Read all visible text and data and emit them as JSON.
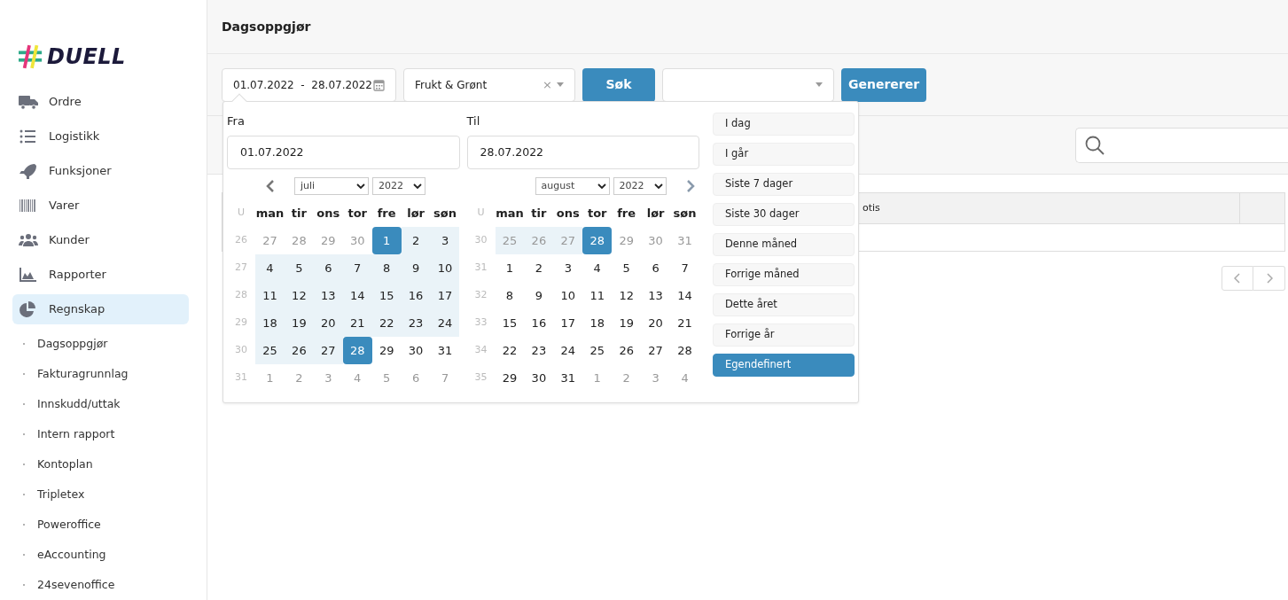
{
  "logo": {
    "text": "DUELL"
  },
  "sidebar": {
    "items": [
      {
        "label": "Ordre",
        "selected": false
      },
      {
        "label": "Logistikk",
        "selected": false
      },
      {
        "label": "Funksjoner",
        "selected": false
      },
      {
        "label": "Varer",
        "selected": false
      },
      {
        "label": "Kunder",
        "selected": false
      },
      {
        "label": "Rapporter",
        "selected": false
      },
      {
        "label": "Regnskap",
        "selected": true,
        "children": [
          {
            "label": "Dagsoppgjør"
          },
          {
            "label": "Fakturagrunnlag"
          },
          {
            "label": "Innskudd/uttak"
          },
          {
            "label": "Intern rapport"
          },
          {
            "label": "Kontoplan"
          },
          {
            "label": "Tripletex"
          },
          {
            "label": "Poweroffice"
          },
          {
            "label": "eAccounting"
          },
          {
            "label": "24sevenoffice"
          }
        ]
      }
    ]
  },
  "header": {
    "title": "Dagsoppgjør"
  },
  "toolbar": {
    "date_range": "01.07.2022  -  28.07.2022",
    "department": "Frukt & Grønt",
    "clear": "×",
    "search_button": "Søk",
    "generate_button": "Genererer"
  },
  "table": {
    "columns": [
      "otis"
    ]
  },
  "datepicker": {
    "from": {
      "label": "Fra",
      "value": "01.07.2022",
      "month": "juli",
      "year": "2022",
      "week_label": "U",
      "weekdays": [
        "man",
        "tir",
        "ons",
        "tor",
        "fre",
        "lør",
        "søn"
      ],
      "weeks": [
        {
          "week": "26",
          "days": [
            {
              "d": "27",
              "muted": true,
              "range": false,
              "selected": false
            },
            {
              "d": "28",
              "muted": true,
              "range": false,
              "selected": false
            },
            {
              "d": "29",
              "muted": true,
              "range": false,
              "selected": false
            },
            {
              "d": "30",
              "muted": true,
              "range": false,
              "selected": false
            },
            {
              "d": "1",
              "muted": false,
              "range": true,
              "selected": true
            },
            {
              "d": "2",
              "muted": false,
              "range": true,
              "selected": false
            },
            {
              "d": "3",
              "muted": false,
              "range": true,
              "selected": false
            }
          ]
        },
        {
          "week": "27",
          "days": [
            {
              "d": "4",
              "muted": false,
              "range": true,
              "selected": false
            },
            {
              "d": "5",
              "muted": false,
              "range": true,
              "selected": false
            },
            {
              "d": "6",
              "muted": false,
              "range": true,
              "selected": false
            },
            {
              "d": "7",
              "muted": false,
              "range": true,
              "selected": false
            },
            {
              "d": "8",
              "muted": false,
              "range": true,
              "selected": false
            },
            {
              "d": "9",
              "muted": false,
              "range": true,
              "selected": false
            },
            {
              "d": "10",
              "muted": false,
              "range": true,
              "selected": false
            }
          ]
        },
        {
          "week": "28",
          "days": [
            {
              "d": "11",
              "muted": false,
              "range": true,
              "selected": false
            },
            {
              "d": "12",
              "muted": false,
              "range": true,
              "selected": false
            },
            {
              "d": "13",
              "muted": false,
              "range": true,
              "selected": false
            },
            {
              "d": "14",
              "muted": false,
              "range": true,
              "selected": false
            },
            {
              "d": "15",
              "muted": false,
              "range": true,
              "selected": false
            },
            {
              "d": "16",
              "muted": false,
              "range": true,
              "selected": false
            },
            {
              "d": "17",
              "muted": false,
              "range": true,
              "selected": false
            }
          ]
        },
        {
          "week": "29",
          "days": [
            {
              "d": "18",
              "muted": false,
              "range": true,
              "selected": false
            },
            {
              "d": "19",
              "muted": false,
              "range": true,
              "selected": false
            },
            {
              "d": "20",
              "muted": false,
              "range": true,
              "selected": false
            },
            {
              "d": "21",
              "muted": false,
              "range": true,
              "selected": false
            },
            {
              "d": "22",
              "muted": false,
              "range": true,
              "selected": false
            },
            {
              "d": "23",
              "muted": false,
              "range": true,
              "selected": false
            },
            {
              "d": "24",
              "muted": false,
              "range": true,
              "selected": false
            }
          ]
        },
        {
          "week": "30",
          "days": [
            {
              "d": "25",
              "muted": false,
              "range": true,
              "selected": false
            },
            {
              "d": "26",
              "muted": false,
              "range": true,
              "selected": false
            },
            {
              "d": "27",
              "muted": false,
              "range": true,
              "selected": false
            },
            {
              "d": "28",
              "muted": false,
              "range": true,
              "selected": true
            },
            {
              "d": "29",
              "muted": false,
              "range": false,
              "selected": false
            },
            {
              "d": "30",
              "muted": false,
              "range": false,
              "selected": false
            },
            {
              "d": "31",
              "muted": false,
              "range": false,
              "selected": false
            }
          ]
        },
        {
          "week": "31",
          "days": [
            {
              "d": "1",
              "muted": true,
              "range": false,
              "selected": false
            },
            {
              "d": "2",
              "muted": true,
              "range": false,
              "selected": false
            },
            {
              "d": "3",
              "muted": true,
              "range": false,
              "selected": false
            },
            {
              "d": "4",
              "muted": true,
              "range": false,
              "selected": false
            },
            {
              "d": "5",
              "muted": true,
              "range": false,
              "selected": false
            },
            {
              "d": "6",
              "muted": true,
              "range": false,
              "selected": false
            },
            {
              "d": "7",
              "muted": true,
              "range": false,
              "selected": false
            }
          ]
        }
      ]
    },
    "to": {
      "label": "Til",
      "value": "28.07.2022",
      "month": "august",
      "year": "2022",
      "week_label": "U",
      "weekdays": [
        "man",
        "tir",
        "ons",
        "tor",
        "fre",
        "lør",
        "søn"
      ],
      "weeks": [
        {
          "week": "30",
          "days": [
            {
              "d": "25",
              "muted": true,
              "range": true,
              "selected": false
            },
            {
              "d": "26",
              "muted": true,
              "range": true,
              "selected": false
            },
            {
              "d": "27",
              "muted": true,
              "range": true,
              "selected": false
            },
            {
              "d": "28",
              "muted": true,
              "range": true,
              "selected": true
            },
            {
              "d": "29",
              "muted": true,
              "range": false,
              "selected": false
            },
            {
              "d": "30",
              "muted": true,
              "range": false,
              "selected": false
            },
            {
              "d": "31",
              "muted": true,
              "range": false,
              "selected": false
            }
          ]
        },
        {
          "week": "31",
          "days": [
            {
              "d": "1",
              "muted": false,
              "range": false,
              "selected": false
            },
            {
              "d": "2",
              "muted": false,
              "range": false,
              "selected": false
            },
            {
              "d": "3",
              "muted": false,
              "range": false,
              "selected": false
            },
            {
              "d": "4",
              "muted": false,
              "range": false,
              "selected": false
            },
            {
              "d": "5",
              "muted": false,
              "range": false,
              "selected": false
            },
            {
              "d": "6",
              "muted": false,
              "range": false,
              "selected": false
            },
            {
              "d": "7",
              "muted": false,
              "range": false,
              "selected": false
            }
          ]
        },
        {
          "week": "32",
          "days": [
            {
              "d": "8",
              "muted": false,
              "range": false,
              "selected": false
            },
            {
              "d": "9",
              "muted": false,
              "range": false,
              "selected": false
            },
            {
              "d": "10",
              "muted": false,
              "range": false,
              "selected": false
            },
            {
              "d": "11",
              "muted": false,
              "range": false,
              "selected": false
            },
            {
              "d": "12",
              "muted": false,
              "range": false,
              "selected": false
            },
            {
              "d": "13",
              "muted": false,
              "range": false,
              "selected": false
            },
            {
              "d": "14",
              "muted": false,
              "range": false,
              "selected": false
            }
          ]
        },
        {
          "week": "33",
          "days": [
            {
              "d": "15",
              "muted": false,
              "range": false,
              "selected": false
            },
            {
              "d": "16",
              "muted": false,
              "range": false,
              "selected": false
            },
            {
              "d": "17",
              "muted": false,
              "range": false,
              "selected": false
            },
            {
              "d": "18",
              "muted": false,
              "range": false,
              "selected": false
            },
            {
              "d": "19",
              "muted": false,
              "range": false,
              "selected": false
            },
            {
              "d": "20",
              "muted": false,
              "range": false,
              "selected": false
            },
            {
              "d": "21",
              "muted": false,
              "range": false,
              "selected": false
            }
          ]
        },
        {
          "week": "34",
          "days": [
            {
              "d": "22",
              "muted": false,
              "range": false,
              "selected": false
            },
            {
              "d": "23",
              "muted": false,
              "range": false,
              "selected": false
            },
            {
              "d": "24",
              "muted": false,
              "range": false,
              "selected": false
            },
            {
              "d": "25",
              "muted": false,
              "range": false,
              "selected": false
            },
            {
              "d": "26",
              "muted": false,
              "range": false,
              "selected": false
            },
            {
              "d": "27",
              "muted": false,
              "range": false,
              "selected": false
            },
            {
              "d": "28",
              "muted": false,
              "range": false,
              "selected": false
            }
          ]
        },
        {
          "week": "35",
          "days": [
            {
              "d": "29",
              "muted": false,
              "range": false,
              "selected": false
            },
            {
              "d": "30",
              "muted": false,
              "range": false,
              "selected": false
            },
            {
              "d": "31",
              "muted": false,
              "range": false,
              "selected": false
            },
            {
              "d": "1",
              "muted": true,
              "range": false,
              "selected": false
            },
            {
              "d": "2",
              "muted": true,
              "range": false,
              "selected": false
            },
            {
              "d": "3",
              "muted": true,
              "range": false,
              "selected": false
            },
            {
              "d": "4",
              "muted": true,
              "range": false,
              "selected": false
            }
          ]
        }
      ]
    },
    "presets": [
      {
        "label": "I dag",
        "selected": false
      },
      {
        "label": "I går",
        "selected": false
      },
      {
        "label": "Siste 7 dager",
        "selected": false
      },
      {
        "label": "Siste 30 dager",
        "selected": false
      },
      {
        "label": "Denne måned",
        "selected": false
      },
      {
        "label": "Forrige måned",
        "selected": false
      },
      {
        "label": "Dette året",
        "selected": false
      },
      {
        "label": "Forrige år",
        "selected": false
      },
      {
        "label": "Egendefinert",
        "selected": true
      }
    ]
  }
}
